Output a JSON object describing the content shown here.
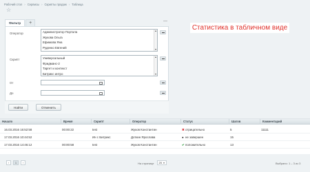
{
  "breadcrumbs": [
    "Рабочий стол",
    "Сервисы",
    "Скрипты продаж",
    "Таблица"
  ],
  "filter": {
    "tab_label": "Фильтр",
    "add_tab_label": "+",
    "collapse_label": "—",
    "operator_label": "Оператор",
    "operator_options": [
      "Администратор Портала",
      "Жукова Ольга",
      "Ефимова Яна",
      "Руденко Евгений"
    ],
    "script_label": "Скрипт",
    "script_options": [
      "Универсальный",
      "Фридманс-2",
      "Таргет и контекст",
      "Битрикс интро"
    ],
    "from_label": "От",
    "to_label": "До",
    "from_value": "",
    "to_value": "",
    "find_button": "Найти",
    "cancel_button": "Отменить"
  },
  "big_title": "Статистика в табличном виде",
  "table": {
    "headers": [
      "Начало",
      "Время",
      "Скрипт",
      "Оператор",
      "Статус",
      "Шагов",
      "Комментарий"
    ],
    "rows": [
      {
        "start": "16.03.2016 16:52:58",
        "time": "00:00:22",
        "script": "test",
        "operator": "Жуков Константин",
        "status_icon": "✖",
        "status_color": "#d9363e",
        "status": "отрицательно",
        "steps": "5",
        "comment": "11111"
      },
      {
        "start": "17.03.2016 10:44:52",
        "time": "",
        "script": "Ин с Битрикс",
        "operator": "Доткин Ярослава",
        "status_icon": "●",
        "status_color": "#222222",
        "status": "не завершен",
        "steps": "15",
        "comment": ""
      },
      {
        "start": "17.03.2016 14:46:12",
        "time": "00:00:58",
        "script": "test",
        "operator": "Жуков Константин",
        "status_icon": "✔",
        "status_color": "#2e9c3f",
        "status": "положительно",
        "steps": "13",
        "comment": ""
      }
    ]
  },
  "pager": {
    "prev": "‹",
    "page": "1",
    "next": "›",
    "per_page_label": "На странице",
    "per_page_value": "20",
    "selected_text": "Выбрано: 1 – 3 из 3"
  },
  "colors": {
    "accent_title": "#e0322c",
    "header_bg": "#d8e0e4"
  }
}
